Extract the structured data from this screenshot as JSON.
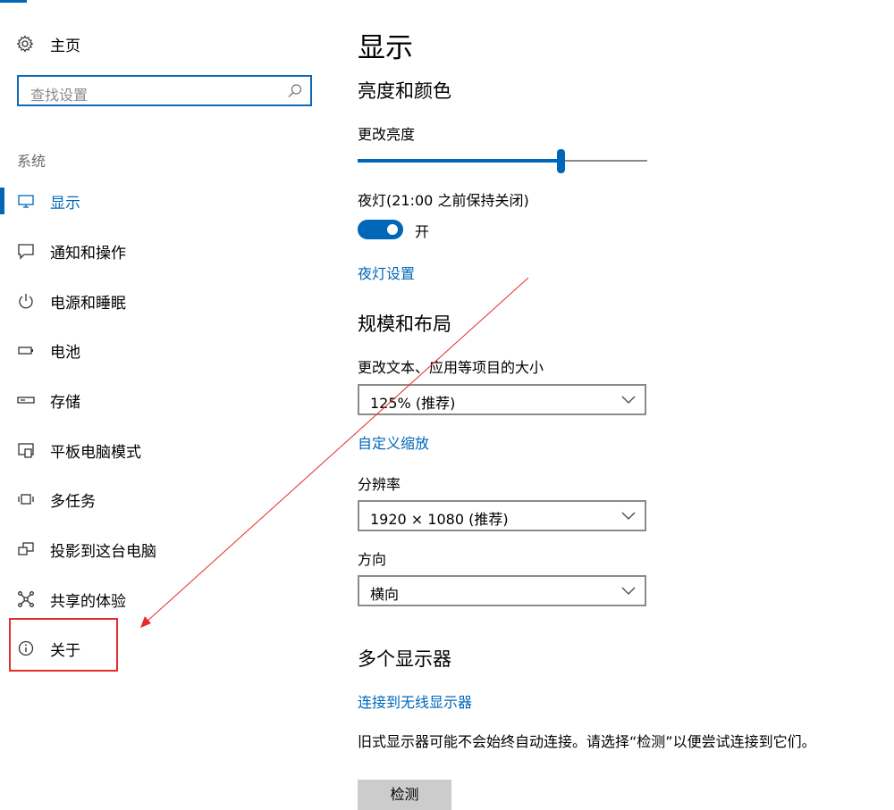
{
  "colors": {
    "accent": "#0067b8",
    "annotation": "#e52b2b"
  },
  "sidebar": {
    "home_label": "主页",
    "home_icon": "gear-icon",
    "search_placeholder": "查找设置",
    "search_icon": "search-icon",
    "group_label": "系统",
    "items": [
      {
        "label": "显示",
        "icon": "monitor-icon",
        "active": true
      },
      {
        "label": "通知和操作",
        "icon": "notification-icon"
      },
      {
        "label": "电源和睡眠",
        "icon": "power-icon"
      },
      {
        "label": "电池",
        "icon": "battery-icon"
      },
      {
        "label": "存储",
        "icon": "storage-icon"
      },
      {
        "label": "平板电脑模式",
        "icon": "tablet-mode-icon"
      },
      {
        "label": "多任务",
        "icon": "multitasking-icon"
      },
      {
        "label": "投影到这台电脑",
        "icon": "projecting-icon"
      },
      {
        "label": "共享的体验",
        "icon": "shared-experiences-icon"
      },
      {
        "label": "关于",
        "icon": "info-icon"
      }
    ]
  },
  "main": {
    "title": "显示",
    "brightness_section": {
      "heading": "亮度和颜色",
      "brightness_label": "更改亮度",
      "brightness_level": 0.7,
      "night_light_label": "夜灯(21:00 之前保持关闭)",
      "night_light_toggle_state": "开",
      "night_light_settings_link": "夜灯设置"
    },
    "scale_section": {
      "heading": "规模和布局",
      "text_size_label": "更改文本、应用等项目的大小",
      "text_size_value": "125% (推荐)",
      "custom_scaling_link": "自定义缩放",
      "resolution_label": "分辨率",
      "resolution_value": "1920 × 1080 (推荐)",
      "orientation_label": "方向",
      "orientation_value": "横向"
    },
    "multi_display_section": {
      "heading": "多个显示器",
      "wireless_link": "连接到无线显示器",
      "description": "旧式显示器可能不会始终自动连接。请选择“检测”以便尝试连接到它们。",
      "detect_button": "检测"
    }
  }
}
